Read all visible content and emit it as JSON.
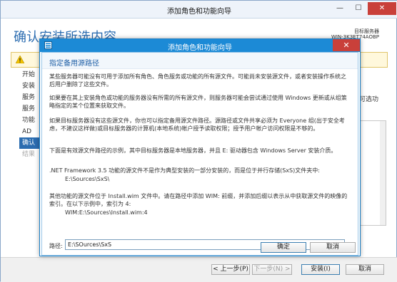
{
  "background_window": {
    "title": "添加角色和功能向导",
    "minimize_glyph": "—",
    "maximize_glyph": "☐",
    "close_glyph": "✕",
    "heading": "确认安装所选内容",
    "server_label": "目标服务器",
    "server_name": "WIN-3K3ET74AOBP",
    "nav": [
      "开始",
      "安装",
      "服务",
      "服务",
      "功能",
      "AD",
      "确认",
      "结果"
    ],
    "right_text": "可选功",
    "buttons": {
      "previous": "< 上一步(P)",
      "next": "下一步(N) >",
      "install": "安装(I)",
      "cancel": "取消"
    }
  },
  "dialog": {
    "title": "添加角色和功能向导",
    "close_glyph": "✕",
    "heading": "指定备用源路径",
    "paragraphs": [
      "某些服务器可能没有可用于添加所有角色、角色服务或功能的所有源文件。可能尚未安装源文件，或者安装操作系统之后用户删除了这些文件。",
      "如果要在其上安装角色或功能的服务器没有所需的所有源文件，则服务器可能会尝试通过使用 Windows 更新或从组策略指定的某个位置来获取文件。",
      "如果目标服务器没有这些源文件，你也可以指定备用源文件路径。源路径或文件共享必须为 Everyone 组(出于安全考虑，不建议这样做)或目标服务器的计算机(本地系统)帐户授予读取权限；授予用户帐户访问权限是不够的。",
      "下面是有效源文件路径的示例，其中目标服务器是本地服务器，并且 E: 驱动器包含 Windows Server 安装介质。",
      ".NET Framework 3.5 功能的源文件不是作为典型安装的一部分安装的，而是位于并行存储(SxS)文件夹中:",
      "E:\\Sources\\SxS\\",
      "其他功能的源文件位于 Install.wim 文件中。请在路径中添加 WIM: 前缀，并添加后缀以表示从中获取源文件的映像的索引。在以下示例中，索引为 4:",
      "WIM:E:\\Sources\\Install.wim:4"
    ],
    "path_label": "路径:",
    "path_value": "E:\\SOurces\\SxS",
    "ok": "确定",
    "cancel": "取消"
  }
}
